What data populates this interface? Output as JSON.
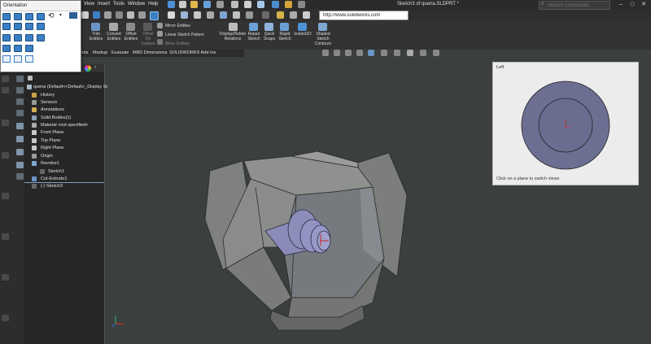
{
  "window": {
    "document_title": "Sketch3 of quena.SLDPRT *",
    "menu": [
      "View",
      "Insert",
      "Tools",
      "Window",
      "Help"
    ],
    "search_placeholder": "Search Commands",
    "min": "–",
    "max": "□",
    "close": "✕"
  },
  "toolbar2": {
    "url": "http://www.solidworks.com"
  },
  "ribbon": {
    "trim": "Trim\nEntities",
    "convert": "Convert\nEntities",
    "offset_entities": "Offset\nEntities",
    "offset_on_surface": "Offset\nOn\nSurface",
    "mirror": "Mirror Entities",
    "linear_pattern": "Linear Sketch Pattern",
    "move": "Move Entities",
    "display_delete": "Display/Delete\nRelations",
    "repair": "Repair\nSketch",
    "quick_snaps": "Quick\nSnaps",
    "rapid_sketch": "Rapid\nSketch",
    "instant2d": "Instant2D",
    "shaded": "Shaded\nSketch\nContours"
  },
  "tabs": [
    "ents",
    "Markup",
    "Evaluate",
    "MBD Dimensions",
    "SOLIDWORKS Add-Ins"
  ],
  "orientation": {
    "title": "Orientation"
  },
  "tree": {
    "root": "quena (Default<<Default>_Display St",
    "items": [
      "History",
      "Sensors",
      "Annotations",
      "Solid Bodies(1)",
      "Material <not specified>",
      "Front Plane",
      "Top Plane",
      "Right Plane",
      "Origin",
      "Revolve1",
      "Sketch1",
      "Cut-Extrude1",
      "(-) Sketch3"
    ]
  },
  "view_panel": {
    "title": "Left",
    "hint": "Click on a plane to switch views"
  },
  "colors": {
    "background": "#3b3f3d",
    "model_face": "#8d8f8d",
    "model_dark": "#6e706e",
    "shaft": "#8a8bb8",
    "preview_disk": "#6c6f92",
    "accent_blue": "#3a7fc4"
  }
}
